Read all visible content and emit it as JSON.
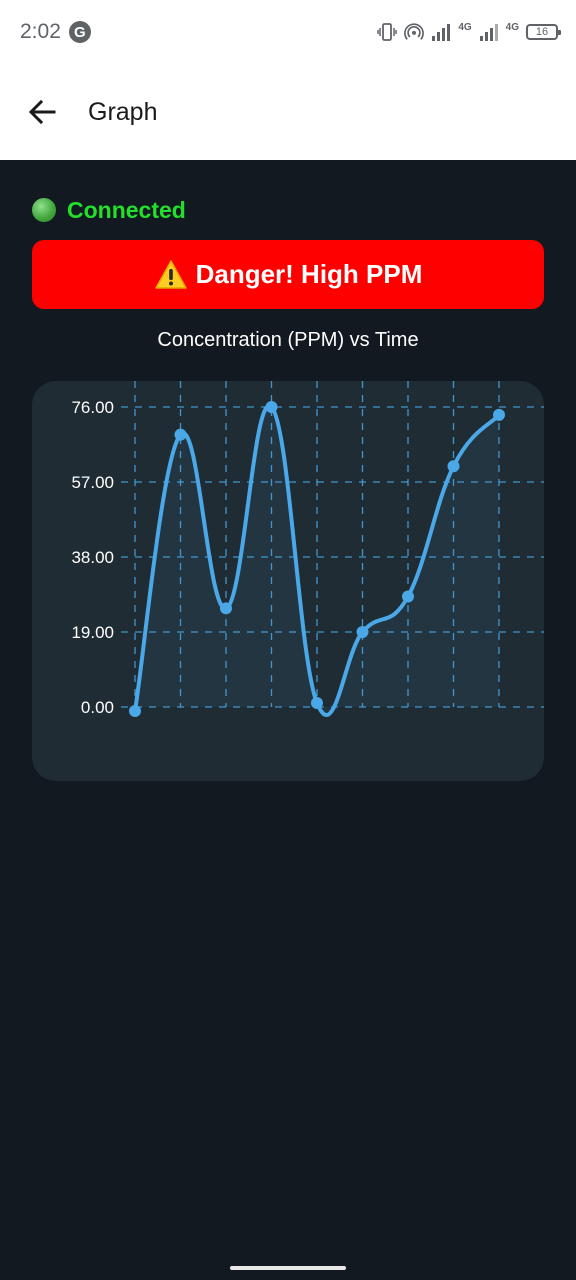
{
  "status_bar": {
    "time": "2:02",
    "google_icon": "G",
    "network_1": "4G",
    "network_2": "4G",
    "battery": "16"
  },
  "app_bar": {
    "title": "Graph",
    "back_icon": "arrow-left"
  },
  "connection": {
    "status": "Connected",
    "color": "#22e02b"
  },
  "alert": {
    "text": "Danger! High PPM",
    "background": "#ff0000",
    "icon": "warning"
  },
  "chart_data": {
    "type": "line",
    "title": "Concentration (PPM) vs Time",
    "xlabel": "",
    "ylabel": "",
    "y_ticks": [
      "76.00",
      "57.00",
      "38.00",
      "19.00",
      "0.00"
    ],
    "ylim": [
      0,
      76
    ],
    "x": [
      0,
      1,
      2,
      3,
      4,
      5,
      6,
      7,
      8
    ],
    "values": [
      -1,
      69,
      25,
      76,
      1,
      19,
      28,
      61,
      74
    ],
    "line_color": "#4aa8e8",
    "grid": true
  }
}
